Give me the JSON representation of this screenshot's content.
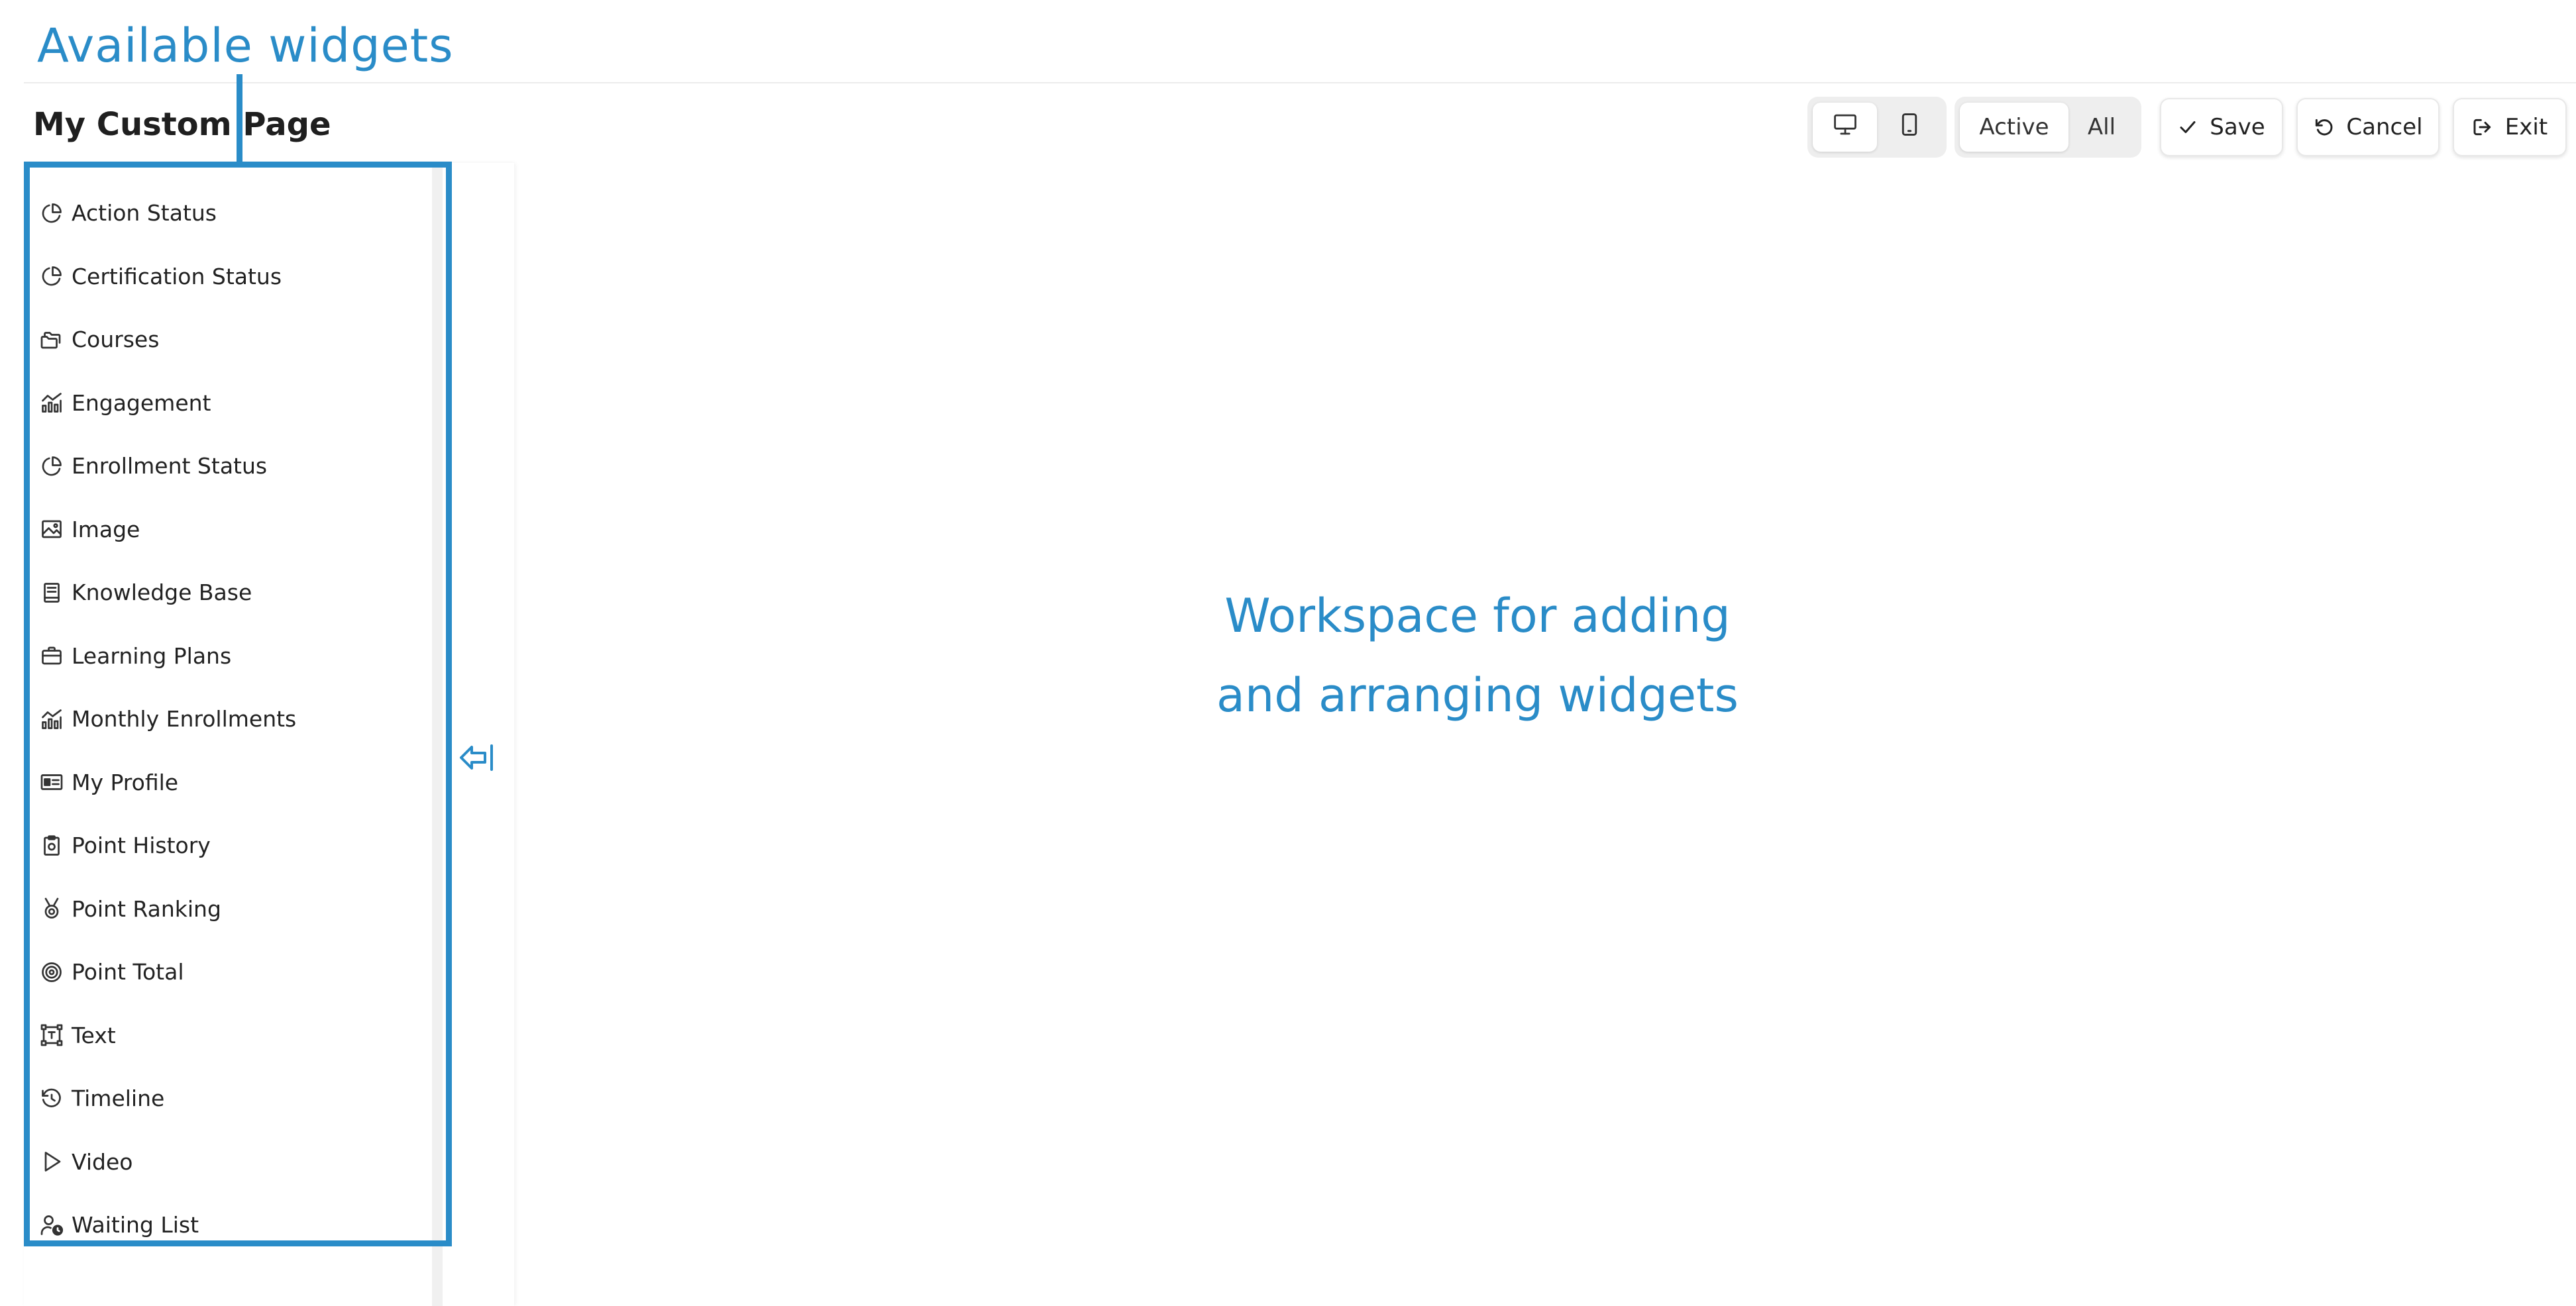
{
  "annotations": {
    "widgets_label": "Available widgets",
    "workspace_line1": "Workspace for adding",
    "workspace_line2": "and arranging widgets"
  },
  "page": {
    "title": "My Custom Page"
  },
  "toolbar": {
    "view_modes": [
      {
        "icon": "desktop-icon",
        "active": true
      },
      {
        "icon": "mobile-icon",
        "active": false
      }
    ],
    "filter": {
      "active_label": "Active",
      "all_label": "All",
      "selected": "Active"
    },
    "save_label": "Save",
    "cancel_label": "Cancel",
    "exit_label": "Exit"
  },
  "widgets": [
    {
      "label": "Action Status",
      "icon": "pie-chart-icon"
    },
    {
      "label": "Certification Status",
      "icon": "pie-chart-icon"
    },
    {
      "label": "Courses",
      "icon": "folders-icon"
    },
    {
      "label": "Engagement",
      "icon": "bar-line-chart-icon"
    },
    {
      "label": "Enrollment Status",
      "icon": "pie-chart-icon"
    },
    {
      "label": "Image",
      "icon": "image-icon"
    },
    {
      "label": "Knowledge Base",
      "icon": "book-icon"
    },
    {
      "label": "Learning Plans",
      "icon": "briefcase-icon"
    },
    {
      "label": "Monthly Enrollments",
      "icon": "bar-line-chart-icon"
    },
    {
      "label": "My Profile",
      "icon": "id-card-icon"
    },
    {
      "label": "Point History",
      "icon": "clipboard-icon"
    },
    {
      "label": "Point Ranking",
      "icon": "medal-icon"
    },
    {
      "label": "Point Total",
      "icon": "target-icon"
    },
    {
      "label": "Text",
      "icon": "text-frame-icon"
    },
    {
      "label": "Timeline",
      "icon": "history-icon"
    },
    {
      "label": "Video",
      "icon": "play-icon"
    },
    {
      "label": "Waiting List",
      "icon": "user-clock-icon"
    }
  ],
  "colors": {
    "annotation": "#2a8cc8",
    "text": "#222222",
    "segment_bg": "#eeeeee"
  }
}
